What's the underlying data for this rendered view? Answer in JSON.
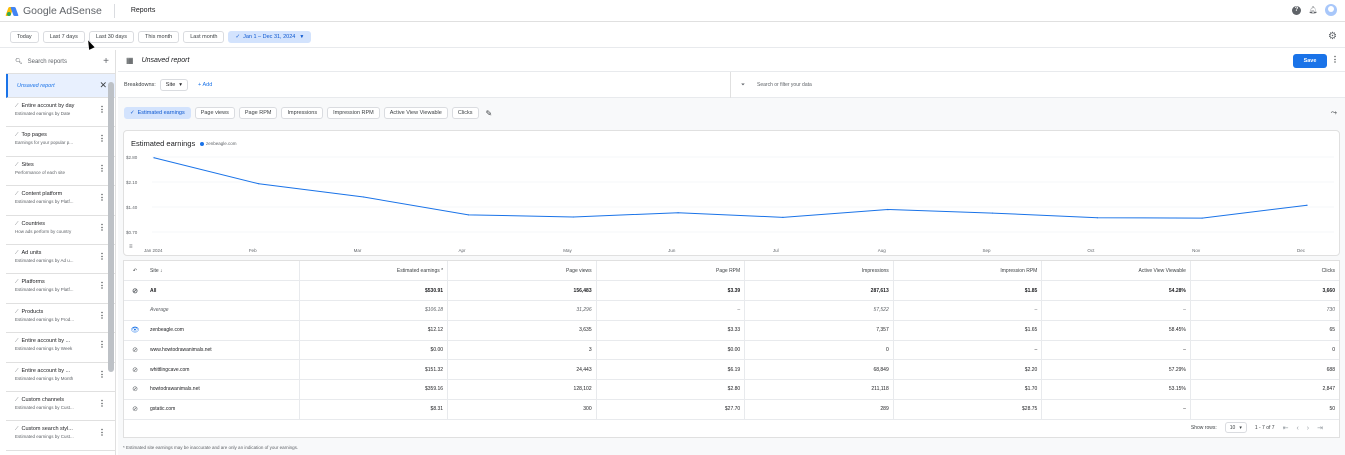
{
  "header": {
    "logo_google": "Google",
    "logo_product": "AdSense",
    "page_title": "Reports"
  },
  "datebar": {
    "chips": [
      "Today",
      "Last 7 days",
      "Last 30 days",
      "This month",
      "Last month"
    ],
    "selected_range": "Jan 1 – Dec 31, 2024"
  },
  "sidebar": {
    "search_placeholder": "Search reports",
    "unsaved_label": "Unsaved report",
    "items": [
      {
        "title": "Entire account by day",
        "subtitle": "Estimated earnings by Date"
      },
      {
        "title": "Top pages",
        "subtitle": "Earnings for your popular p..."
      },
      {
        "title": "Sites",
        "subtitle": "Performance of each site"
      },
      {
        "title": "Content platform",
        "subtitle": "Estimated earnings by Platf..."
      },
      {
        "title": "Countries",
        "subtitle": "How ads perform by country"
      },
      {
        "title": "Ad units",
        "subtitle": "Estimated earnings by Ad u..."
      },
      {
        "title": "Platforms",
        "subtitle": "Estimated earnings by Platf..."
      },
      {
        "title": "Products",
        "subtitle": "Estimated earnings by Prod..."
      },
      {
        "title": "Entire account by ...",
        "subtitle": "Estimated earnings by Week"
      },
      {
        "title": "Entire account by ...",
        "subtitle": "Estimated earnings by Month"
      },
      {
        "title": "Custom channels",
        "subtitle": "Estimated earnings by Cust..."
      },
      {
        "title": "Custom search styl...",
        "subtitle": "Estimated earnings by Cust..."
      }
    ]
  },
  "report": {
    "title": "Unsaved report",
    "save_label": "Save",
    "breakdowns_label": "Breakdowns:",
    "breakdown_value": "Site",
    "add_label": "Add",
    "filter_placeholder": "Search or filter your data",
    "metrics": [
      "Estimated earnings",
      "Page views",
      "Page RPM",
      "Impressions",
      "Impression RPM",
      "Active View Viewable",
      "Clicks"
    ]
  },
  "chart_data": {
    "type": "line",
    "title": "Estimated earnings",
    "legend": "zenbeagle.com",
    "y_ticks": [
      "$2.80",
      "$2.10",
      "$1.40",
      "$0.70"
    ],
    "ylim": [
      0.7,
      2.8
    ],
    "x_labels": [
      "Jan 2024",
      "Feb",
      "Mar",
      "Apr",
      "May",
      "Jun",
      "Jul",
      "Aug",
      "Sep",
      "Oct",
      "Nov",
      "Dec"
    ],
    "series": [
      {
        "name": "zenbeagle.com",
        "color": "#1a73e8",
        "x": [
          "Jan 2024",
          "Feb",
          "Mar",
          "Apr",
          "May",
          "Jun",
          "Jul",
          "Aug",
          "Sep",
          "Oct",
          "Nov",
          "Dec"
        ],
        "values": [
          2.78,
          2.05,
          1.68,
          1.18,
          1.12,
          1.24,
          1.11,
          1.33,
          1.23,
          1.1,
          1.09,
          1.45
        ]
      }
    ]
  },
  "table": {
    "headers": [
      "Site",
      "Estimated earnings *",
      "Page views",
      "Page RPM",
      "Impressions",
      "Impression RPM",
      "Active View Viewable",
      "Clicks"
    ],
    "rows": [
      {
        "type": "all",
        "cells": [
          "All",
          "$530.91",
          "156,483",
          "$3.39",
          "287,613",
          "$1.85",
          "54.28%",
          "3,660"
        ]
      },
      {
        "type": "avg",
        "cells": [
          "Average",
          "$106.18",
          "31,296",
          "–",
          "57,522",
          "–",
          "–",
          "730"
        ]
      },
      {
        "type": "row",
        "visible": true,
        "cells": [
          "zenbeagle.com",
          "$12.12",
          "3,635",
          "$3.33",
          "7,357",
          "$1.65",
          "58.45%",
          "65"
        ]
      },
      {
        "type": "row",
        "visible": false,
        "cells": [
          "www.howtodrawanimals.net",
          "$0.00",
          "3",
          "$0.00",
          "0",
          "–",
          "–",
          "0"
        ]
      },
      {
        "type": "row",
        "visible": false,
        "cells": [
          "whittlingcave.com",
          "$151.32",
          "24,443",
          "$6.19",
          "68,849",
          "$2.20",
          "57.29%",
          "688"
        ]
      },
      {
        "type": "row",
        "visible": false,
        "cells": [
          "howtodrawanimals.net",
          "$359.16",
          "128,102",
          "$2.80",
          "211,118",
          "$1.70",
          "53.15%",
          "2,847"
        ]
      },
      {
        "type": "row",
        "visible": false,
        "cells": [
          "gstatic.com",
          "$8.31",
          "300",
          "$27.70",
          "289",
          "$28.75",
          "–",
          "50"
        ]
      }
    ],
    "show_rows_label": "Show rows:",
    "rows_per_page": "10",
    "page_range": "1 - 7 of 7"
  },
  "footnote": "* Estimated site earnings may be inaccurate and are only an indication of your earnings."
}
